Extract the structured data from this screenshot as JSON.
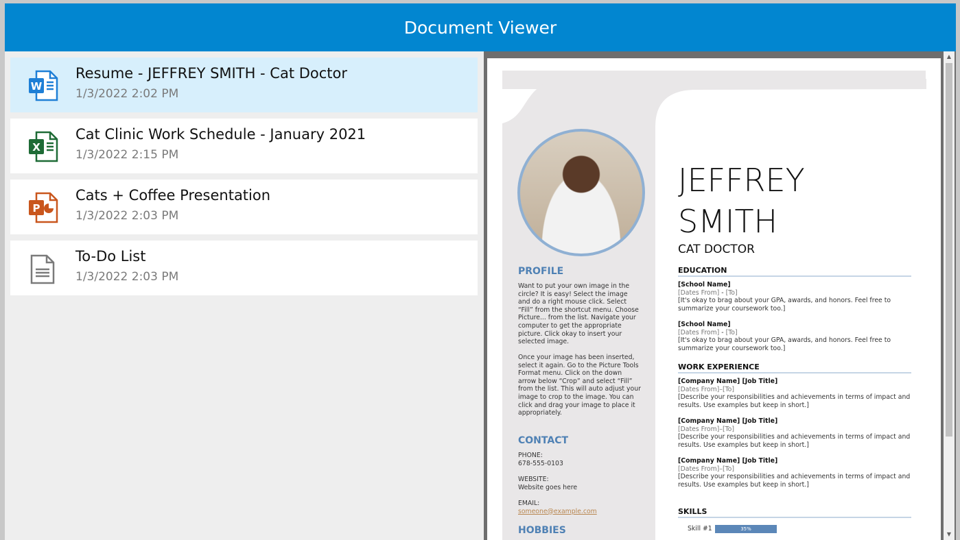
{
  "app": {
    "title": "Document Viewer"
  },
  "documents": [
    {
      "title": "Resume - JEFFREY SMITH - Cat Doctor",
      "date": "1/3/2022 2:02 PM",
      "icon": "word-icon",
      "color": "#1e7fd6",
      "selected": true
    },
    {
      "title": "Cat Clinic Work Schedule - January 2021",
      "date": "1/3/2022 2:15 PM",
      "icon": "excel-icon",
      "color": "#1e6b36",
      "selected": false
    },
    {
      "title": "Cats + Coffee Presentation",
      "date": "1/3/2022 2:03 PM",
      "icon": "powerpoint-icon",
      "color": "#c9561d",
      "selected": false
    },
    {
      "title": "To-Do List",
      "date": "1/3/2022 2:03 PM",
      "icon": "text-file-icon",
      "color": "#7a7a7a",
      "selected": false
    }
  ],
  "resume": {
    "first": "JEFFREY",
    "last": "SMITH",
    "role": "CAT DOCTOR",
    "profile": {
      "heading": "PROFILE",
      "p1": "Want to put your own image in the circle?  It is easy!  Select the image and do a right mouse click.  Select “Fill” from the shortcut menu.  Choose Picture... from the list.  Navigate your computer to get the appropriate picture.  Click okay to insert your selected image.",
      "p2": "Once your image has been inserted, select it again.  Go to the Picture Tools Format menu. Click on the down arrow below “Crop” and select “Fill” from the list.  This will auto adjust your image to crop to the image.  You can click and drag your image to place it appropriately."
    },
    "contact": {
      "heading": "CONTACT",
      "phone_label": "PHONE:",
      "phone": "678-555-0103",
      "website_label": "WEBSITE:",
      "website": "Website goes here",
      "email_label": "EMAIL:",
      "email": "someone@example.com"
    },
    "hobbies": {
      "heading": "HOBBIES"
    },
    "education": {
      "heading": "EDUCATION",
      "entries": [
        {
          "name": "[School Name]",
          "dates1": "[Dates From]",
          "sep": " - ",
          "dates2": "[To]",
          "desc": "[It's okay to brag about your GPA, awards, and honors. Feel free to summarize your coursework too.]"
        },
        {
          "name": "[School Name]",
          "dates1": "[Dates From]",
          "sep": " - ",
          "dates2": "[To]",
          "desc": "[It's okay to brag about your GPA, awards, and honors. Feel free to summarize your coursework too.]"
        }
      ]
    },
    "work": {
      "heading": "WORK EXPERIENCE",
      "entries": [
        {
          "name": "[Company Name]  [Job Title]",
          "dates": "[Dates From]–[To]",
          "desc": "[Describe your responsibilities and achievements in terms of impact and results. Use examples but keep in short.]"
        },
        {
          "name": "[Company Name]  [Job Title]",
          "dates": "[Dates From]–[To]",
          "desc": "[Describe your responsibilities and achievements in terms of impact and results. Use examples but keep in short.]"
        },
        {
          "name": "[Company Name]  [Job Title]",
          "dates": "[Dates From]–[To]",
          "desc": "[Describe your responsibilities and achievements in terms of impact and results. Use examples but keep in short.]"
        }
      ]
    },
    "skills": {
      "heading": "SKILLS",
      "items": [
        {
          "name": "Skill #1",
          "label": "35%",
          "value": 35
        }
      ]
    }
  }
}
